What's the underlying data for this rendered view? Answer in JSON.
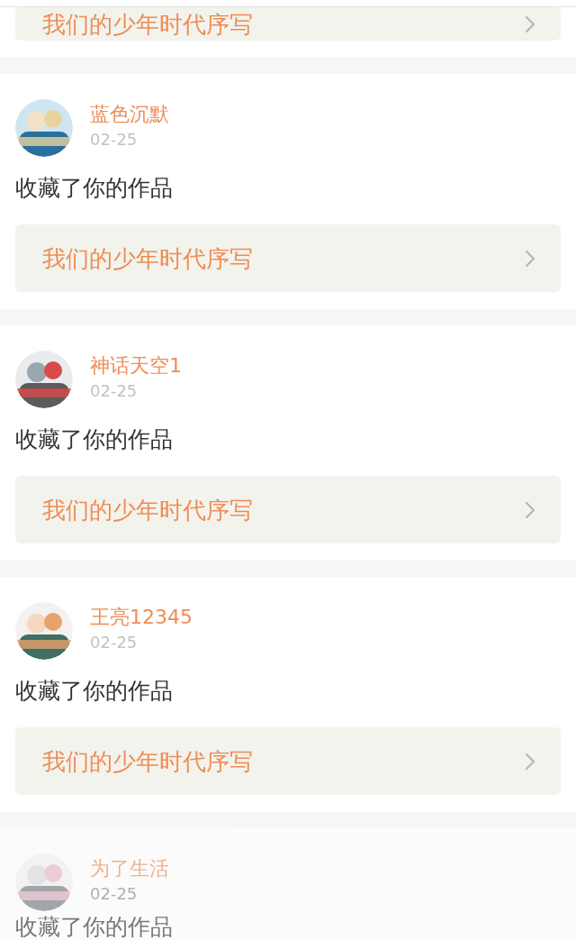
{
  "top_card": {
    "work_link": "我们的少年时代序写"
  },
  "notifications": [
    {
      "user": "蓝色沉默",
      "date": "02-25",
      "action": "收藏了你的作品",
      "work_link": "我们的少年时代序写",
      "dimmed": false
    },
    {
      "user": "神话天空1",
      "date": "02-25",
      "action": "收藏了你的作品",
      "work_link": "我们的少年时代序写",
      "dimmed": false
    },
    {
      "user": "王亮12345",
      "date": "02-25",
      "action": "收藏了你的作品",
      "work_link": "我们的少年时代序写",
      "dimmed": false
    },
    {
      "user": "为了生活",
      "date": "02-25",
      "action": "收藏了你的作品",
      "dimmed": true
    }
  ]
}
